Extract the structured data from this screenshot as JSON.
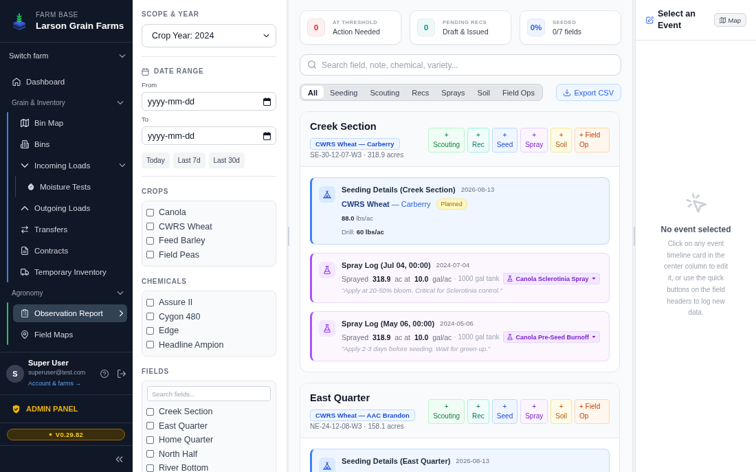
{
  "sidebar": {
    "brand": {
      "caption": "FARM BASE",
      "name": "Larson Grain Farms"
    },
    "farm_switcher": "Switch farm",
    "items": [
      {
        "label": "Dashboard",
        "selected": false
      }
    ],
    "sections": [
      {
        "title": "Grain & Inventory",
        "expanded": true,
        "color": "#3b82f6",
        "items": [
          {
            "label": "Bin Map",
            "selected": false
          },
          {
            "label": "Bins",
            "selected": false
          },
          {
            "label": "Incoming Loads",
            "selected": false,
            "expanded": true,
            "children": [
              {
                "label": "Moisture Tests",
                "selected": false
              }
            ]
          },
          {
            "label": "Outgoing Loads",
            "selected": false
          },
          {
            "label": "Transfers",
            "selected": false
          },
          {
            "label": "Contracts",
            "selected": false
          },
          {
            "label": "Temporary Inventory",
            "selected": false
          }
        ]
      },
      {
        "title": "Agronomy",
        "expanded": true,
        "color": "#22c55e",
        "items": [
          {
            "label": "Observation Report",
            "selected": true
          },
          {
            "label": "Field Maps",
            "selected": false
          }
        ]
      }
    ],
    "user": {
      "initial": "S",
      "name": "Super User",
      "email": "superuser@test.com",
      "account_link": "Account & farms →"
    },
    "admin_panel": "ADMIN PANEL",
    "version": "V0.29.82"
  },
  "filters": {
    "scope": {
      "title": "SCOPE & YEAR",
      "value": "Crop Year: 2024"
    },
    "date_range": {
      "title": "DATE RANGE",
      "from": {
        "label": "From",
        "placeholder": "yyyy-mm-dd"
      },
      "to": {
        "label": "To",
        "placeholder": "yyyy-mm-dd"
      },
      "presets": [
        "Today",
        "Last 7d",
        "Last 30d"
      ]
    },
    "groups": [
      {
        "title": "CROPS",
        "options": [
          {
            "label": "Canola",
            "checked": false
          },
          {
            "label": "CWRS Wheat",
            "checked": false
          },
          {
            "label": "Feed Barley",
            "checked": false
          },
          {
            "label": "Field Peas",
            "checked": false
          }
        ]
      },
      {
        "title": "CHEMICALS",
        "options": [
          {
            "label": "Assure II",
            "checked": false
          },
          {
            "label": "Cygon 480",
            "checked": false
          },
          {
            "label": "Edge",
            "checked": false
          },
          {
            "label": "Headline Ampion",
            "checked": false
          }
        ]
      },
      {
        "title": "FIELDS",
        "search": {
          "placeholder": "Search fields..."
        },
        "options": [
          {
            "label": "Creek Section",
            "checked": false
          },
          {
            "label": "East Quarter",
            "checked": false
          },
          {
            "label": "Home Quarter",
            "checked": false
          },
          {
            "label": "North Half",
            "checked": false
          },
          {
            "label": "River Bottom",
            "checked": false
          }
        ]
      }
    ]
  },
  "summary": [
    {
      "value": "0",
      "label": "AT THRESHOLD",
      "caption": "Action Needed",
      "color": "#dc2626"
    },
    {
      "value": "0",
      "label": "PENDING RECS",
      "caption": "Draft & Issued",
      "color": "#0d9488"
    },
    {
      "value": "0%",
      "label": "SEEDED",
      "caption": "0/7 fields",
      "color": "#2563eb"
    }
  ],
  "search": {
    "placeholder": "Search field, note, chemical, variety..."
  },
  "tabs": [
    {
      "label": "All",
      "selected": true
    },
    {
      "label": "Seeding",
      "selected": false
    },
    {
      "label": "Scouting",
      "selected": false
    },
    {
      "label": "Recs",
      "selected": false
    },
    {
      "label": "Sprays",
      "selected": false
    },
    {
      "label": "Soil",
      "selected": false
    },
    {
      "label": "Field Ops",
      "selected": false
    }
  ],
  "export_button": "Export CSV",
  "field_cards": [
    {
      "name": "Creek Section",
      "crop": "CWRS Wheat — Carberry",
      "location": "SE-30-12-07-W3 · 318.9 acres",
      "quick_actions": [
        {
          "label": "+ Scouting",
          "kind": "scouting"
        },
        {
          "label": "+ Rec",
          "kind": "rec"
        },
        {
          "label": "+ Seed",
          "kind": "seed"
        },
        {
          "label": "+ Spray",
          "kind": "spray"
        },
        {
          "label": "+ Soil",
          "kind": "soil"
        },
        {
          "label": "+ Field Op",
          "kind": "field_op"
        }
      ],
      "events": [
        {
          "kind": "seeding",
          "title": "Seeding Details (Creek Section)",
          "date": "2026-08-13",
          "crop": "**CWRS Wheat** — Carberry",
          "status": "Planned",
          "rate": "**88.0** lbs/ac",
          "drill": "Drill: **60 lbs/ac**"
        },
        {
          "kind": "spray",
          "title": "Spray Log (Jul 04, 00:00)",
          "date": "2024-07-04",
          "application": "Sprayed **318.9** ac at **10.0** gal/ac",
          "tank": "· 1000 gal tank",
          "product": "Canola Sclerotinia Spray",
          "note": "\"Apply at 20-50% bloom. Critical for Sclerotinia control.\""
        },
        {
          "kind": "spray",
          "title": "Spray Log (May 06, 00:00)",
          "date": "2024-05-06",
          "application": "Sprayed **318.9** ac at **10.0** gal/ac",
          "tank": "· 1000 gal tank",
          "product": "Canola Pre-Seed Burnoff",
          "note": "\"Apply 2-3 days before seeding. Wait for green-up.\""
        }
      ]
    },
    {
      "name": "East Quarter",
      "crop": "CWRS Wheat — AAC Brandon",
      "location": "NE-24-12-08-W3 · 158.1 acres",
      "quick_actions": [
        {
          "label": "+ Scouting",
          "kind": "scouting"
        },
        {
          "label": "+ Rec",
          "kind": "rec"
        },
        {
          "label": "+ Seed",
          "kind": "seed"
        },
        {
          "label": "+ Spray",
          "kind": "spray"
        },
        {
          "label": "+ Soil",
          "kind": "soil"
        },
        {
          "label": "+ Field Op",
          "kind": "field_op"
        }
      ],
      "events": [
        {
          "kind": "seeding",
          "title": "Seeding Details (East Quarter)",
          "date": "2026-08-13"
        }
      ]
    }
  ],
  "detail": {
    "title": "Select an Event",
    "map_button": "Map",
    "empty_title": "No event selected",
    "empty_text": "Click on any event timeline card in the center column to edit it, or use the quick buttons on the field headers to log new data."
  }
}
